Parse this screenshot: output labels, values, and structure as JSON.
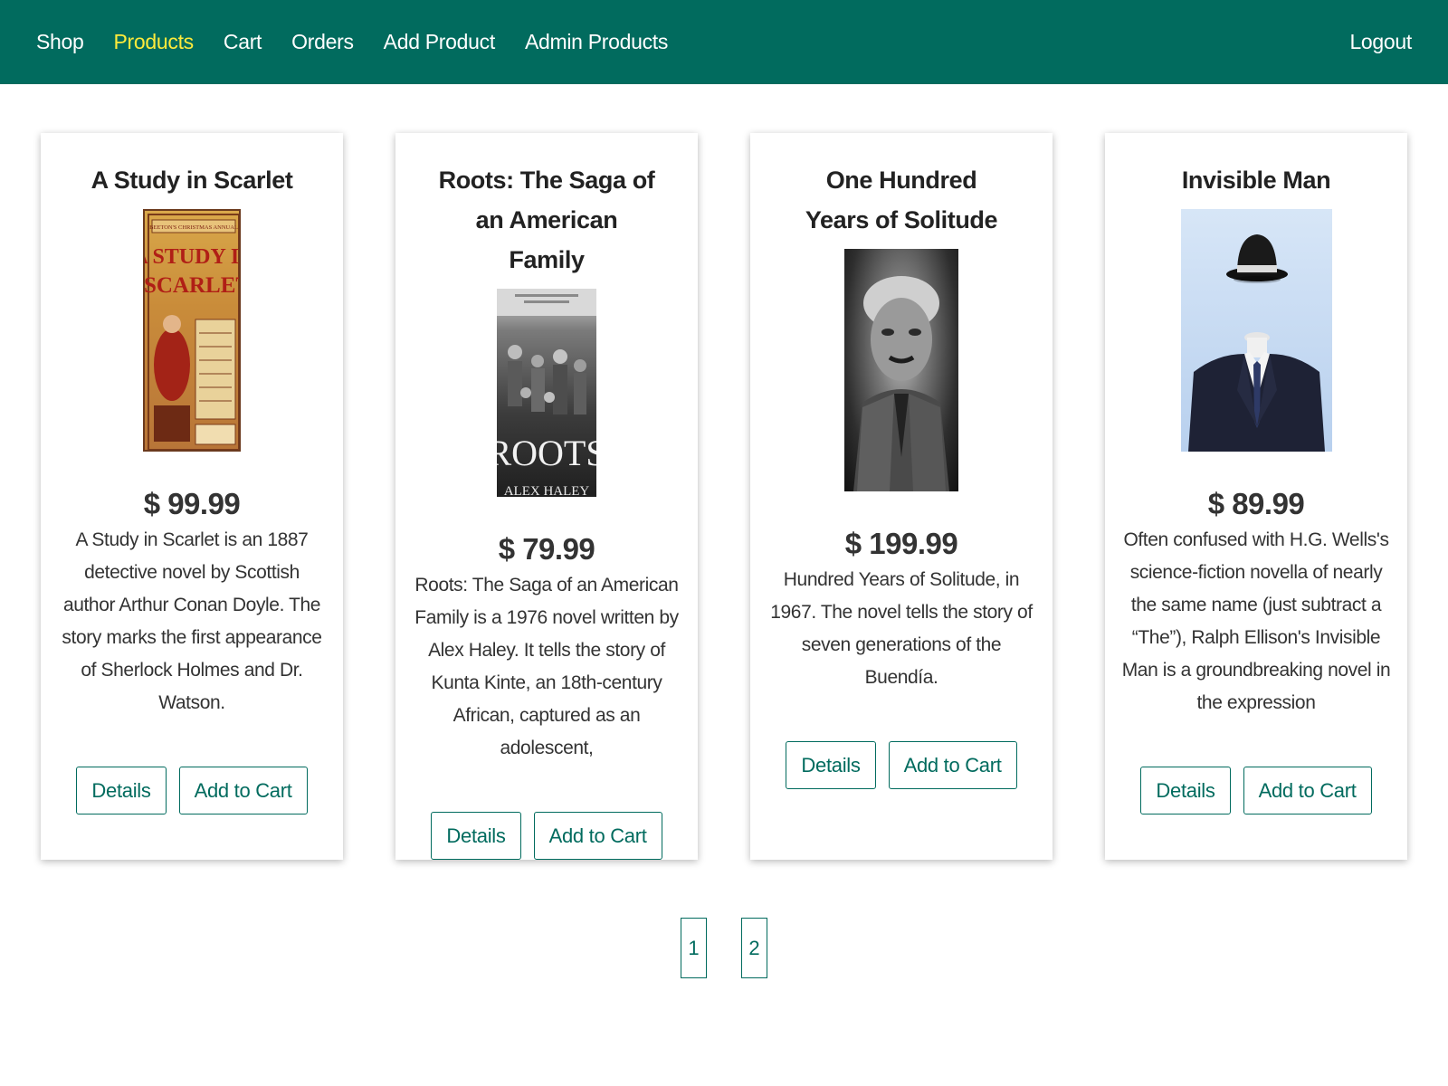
{
  "nav": {
    "items": [
      {
        "label": "Shop",
        "active": false
      },
      {
        "label": "Products",
        "active": true
      },
      {
        "label": "Cart",
        "active": false
      },
      {
        "label": "Orders",
        "active": false
      },
      {
        "label": "Add Product",
        "active": false
      },
      {
        "label": "Admin Products",
        "active": false
      }
    ],
    "logout_label": "Logout"
  },
  "products": [
    {
      "title": "A Study in Scarlet",
      "price": "$ 99.99",
      "description": "A Study in Scarlet is an 1887 detective novel by Scottish author Arthur Conan Doyle. The story marks the first appearance of Sherlock Holmes and Dr. Watson.",
      "image": "book-cover-study-in-scarlet",
      "details_label": "Details",
      "add_to_cart_label": "Add to Cart"
    },
    {
      "title": "Roots: The Saga of an American Family",
      "price": "$ 79.99",
      "description": "Roots: The Saga of an American Family is a 1976 novel written by Alex Haley. It tells the story of Kunta Kinte, an 18th-century African, captured as an adolescent,",
      "image": "book-cover-roots",
      "details_label": "Details",
      "add_to_cart_label": "Add to Cart"
    },
    {
      "title": "One Hundred Years of Solitude",
      "price": "$ 199.99",
      "description": "Hundred Years of Solitude, in 1967. The novel tells the story of seven generations of the Buendía.",
      "image": "author-portrait",
      "details_label": "Details",
      "add_to_cart_label": "Add to Cart"
    },
    {
      "title": "Invisible Man",
      "price": "$ 89.99",
      "description": "Often confused with H.G. Wells's science-fiction novella of nearly the same name (just subtract a “The”), Ralph Ellison's Invisible Man is a groundbreaking novel in the expression",
      "image": "invisible-man-suit-and-hat",
      "details_label": "Details",
      "add_to_cart_label": "Add to Cart"
    }
  ],
  "cover_art": {
    "scarlet_header": "BEETON'S CHRISTMAS ANNUAL",
    "scarlet_title_1": "A STUDY IN",
    "scarlet_title_2": "SCARLET",
    "roots_title": "ROOTS",
    "roots_author": "ALEX HALEY"
  },
  "pagination": {
    "pages": [
      "1",
      "2"
    ]
  },
  "colors": {
    "brand": "#016b5e",
    "active_nav": "#ffeb3b"
  }
}
